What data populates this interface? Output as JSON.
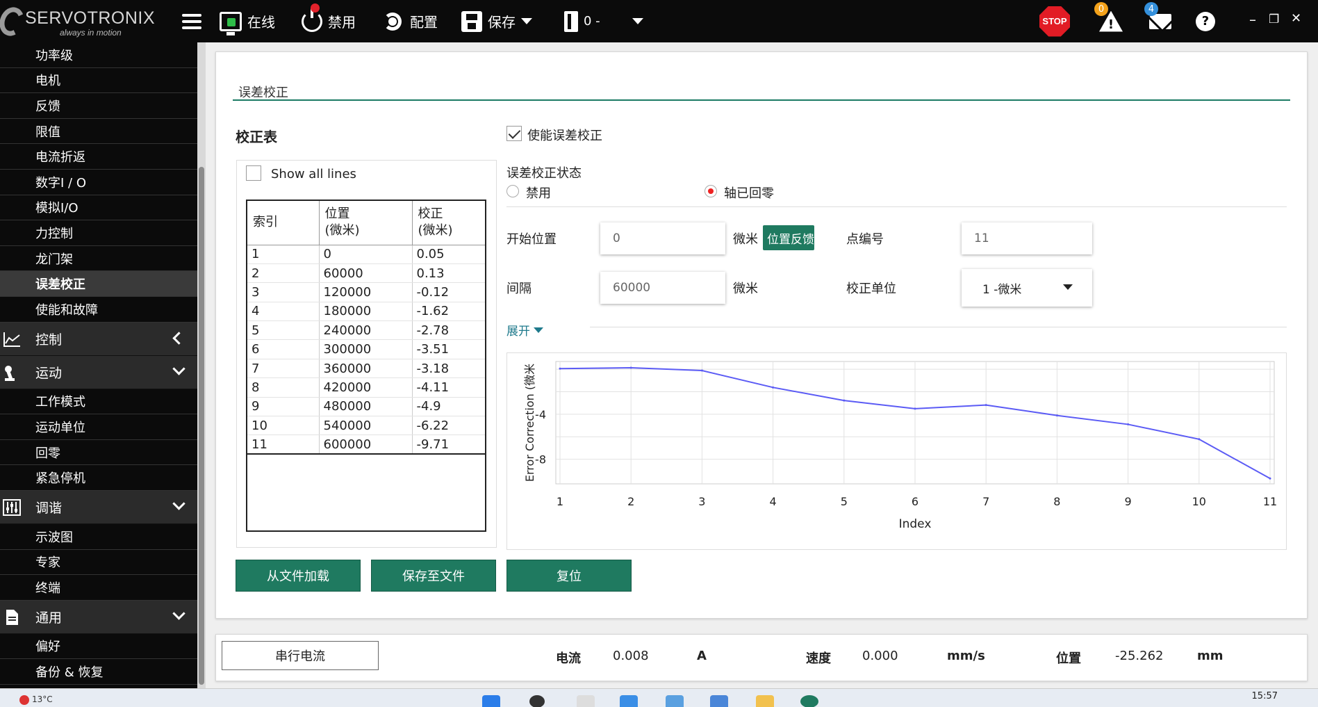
{
  "topbar": {
    "brand": "SERVOTRONIX",
    "tagline": "always in motion",
    "online_label": "在线",
    "disable_label": "禁用",
    "config_label": "配置",
    "save_label": "保存",
    "drive_label": "0 -",
    "stop_label": "STOP",
    "warning_count": "0",
    "message_count": "4",
    "help_label": "?",
    "minimize": "–",
    "restore": "❐",
    "close": "✕"
  },
  "sidebar": {
    "items_top": [
      "功率级",
      "电机",
      "反馈",
      "限值",
      "电流折返",
      "数字I / O",
      "模拟I/O",
      "力控制",
      "龙门架",
      "误差校正",
      "使能和故障"
    ],
    "active_item": "误差校正",
    "group_control": "控制",
    "group_motion": "运动",
    "motion_items": [
      "工作模式",
      "运动单位",
      "回零",
      "紧急停机"
    ],
    "group_tuning": "调谐",
    "tuning_items": [
      "示波图",
      "专家",
      "终端"
    ],
    "group_general": "通用",
    "general_items": [
      "偏好",
      "备份 & 恢复"
    ]
  },
  "main": {
    "section_title": "误差校正",
    "table_title": "校正表",
    "show_all_lines": "Show all lines",
    "table_headers": {
      "index": "索引",
      "position": "位置",
      "position_unit": "(微米)",
      "correction": "校正",
      "correction_unit": "(微米)"
    },
    "rows": [
      {
        "index": "1",
        "position": "0",
        "correction": "0.05"
      },
      {
        "index": "2",
        "position": "60000",
        "correction": "0.13"
      },
      {
        "index": "3",
        "position": "120000",
        "correction": "-0.12"
      },
      {
        "index": "4",
        "position": "180000",
        "correction": "-1.62"
      },
      {
        "index": "5",
        "position": "240000",
        "correction": "-2.78"
      },
      {
        "index": "6",
        "position": "300000",
        "correction": "-3.51"
      },
      {
        "index": "7",
        "position": "360000",
        "correction": "-3.18"
      },
      {
        "index": "8",
        "position": "420000",
        "correction": "-4.11"
      },
      {
        "index": "9",
        "position": "480000",
        "correction": "-4.9"
      },
      {
        "index": "10",
        "position": "540000",
        "correction": "-6.22"
      },
      {
        "index": "11",
        "position": "600000",
        "correction": "-9.71"
      }
    ],
    "enable_label": "使能误差校正",
    "status_label": "误差校正状态",
    "status_disabled": "禁用",
    "status_homed": "轴已回零",
    "start_pos_label": "开始位置",
    "start_pos_value": "0",
    "unit_um": "微米",
    "pos_feedback_btn": "位置反馈",
    "point_num_label": "点编号",
    "point_num_value": "11",
    "interval_label": "间隔",
    "interval_value": "60000",
    "unit_um2": "微米",
    "corr_unit_label": "校正单位",
    "corr_unit_value": "1 -微米",
    "expand_label": "展开",
    "load_btn": "从文件加载",
    "save_btn": "保存至文件",
    "reset_btn": "复位"
  },
  "chart_data": {
    "type": "line",
    "x": [
      1,
      2,
      3,
      4,
      5,
      6,
      7,
      8,
      9,
      10,
      11
    ],
    "series": [
      {
        "values": [
          0.05,
          0.13,
          -0.12,
          -1.62,
          -2.78,
          -3.51,
          -3.18,
          -4.11,
          -4.9,
          -6.22,
          -9.71
        ]
      }
    ],
    "xlabel": "Index",
    "ylabel": "Error Correction (微米",
    "yticks": [
      -4,
      -8
    ],
    "xticks": [
      "1",
      "2",
      "3",
      "4",
      "5",
      "6",
      "7",
      "8",
      "9",
      "10",
      "11"
    ],
    "xlim": [
      1,
      11
    ],
    "ylim": [
      -10,
      0.5
    ],
    "grid": true,
    "line_color": "#5b5bf5"
  },
  "statusbar": {
    "serial_btn": "串行电流",
    "current_label": "电流",
    "current_value": "0.008",
    "current_unit": "A",
    "speed_label": "速度",
    "speed_value": "0.000",
    "speed_unit": "mm/s",
    "pos_label": "位置",
    "pos_value": "-25.262",
    "pos_unit": "mm"
  },
  "taskbar": {
    "weather": "13°C",
    "clock": "15:57"
  }
}
